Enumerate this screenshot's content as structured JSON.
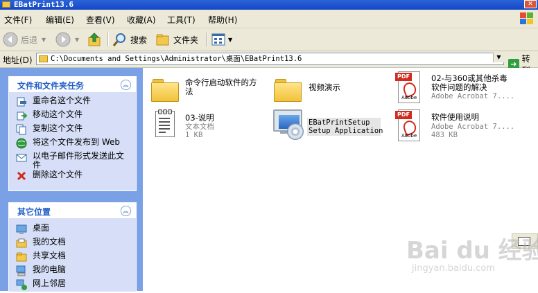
{
  "window": {
    "title": "EBatPrint13.6"
  },
  "menu": [
    "文件(F)",
    "编辑(E)",
    "查看(V)",
    "收藏(A)",
    "工具(T)",
    "帮助(H)"
  ],
  "toolbar": {
    "back": "后退",
    "search": "搜索",
    "folders": "文件夹"
  },
  "address": {
    "label": "地址(D)",
    "path": "C:\\Documents and Settings\\Administrator\\桌面\\EBatPrint13.6",
    "go": "转到"
  },
  "tasks": {
    "title": "文件和文件夹任务",
    "items": [
      "重命名这个文件",
      "移动这个文件",
      "复制这个文件",
      "将这个文件发布到 Web",
      "以电子邮件形式发送此文件",
      "删除这个文件"
    ]
  },
  "places": {
    "title": "其它位置",
    "items": [
      "桌面",
      "我的文档",
      "共享文档",
      "我的电脑",
      "网上邻居"
    ]
  },
  "files": [
    {
      "name": "命令行启动软件的方法",
      "type": "",
      "size": ""
    },
    {
      "name": "视频演示",
      "type": "",
      "size": ""
    },
    {
      "name": "02-与360或其他杀毒软件问题的解决",
      "type": "Adobe Acrobat 7....",
      "size": ""
    },
    {
      "name": "03-说明",
      "type": "文本文档",
      "size": "1 KB"
    },
    {
      "name": "EBatPrintSetup",
      "type": "Setup Application",
      "size": ""
    },
    {
      "name": "软件使用说明",
      "type": "Adobe Acrobat 7....",
      "size": "483 KB"
    }
  ],
  "watermark": {
    "brand": "Bai du 经验",
    "url": "jingyan.baidu.com"
  },
  "colors": {
    "titlebar": "#2a63d8",
    "taskpane": "#7aa1e6",
    "panel_title": "#215dc6",
    "chrome": "#ece9d8"
  }
}
